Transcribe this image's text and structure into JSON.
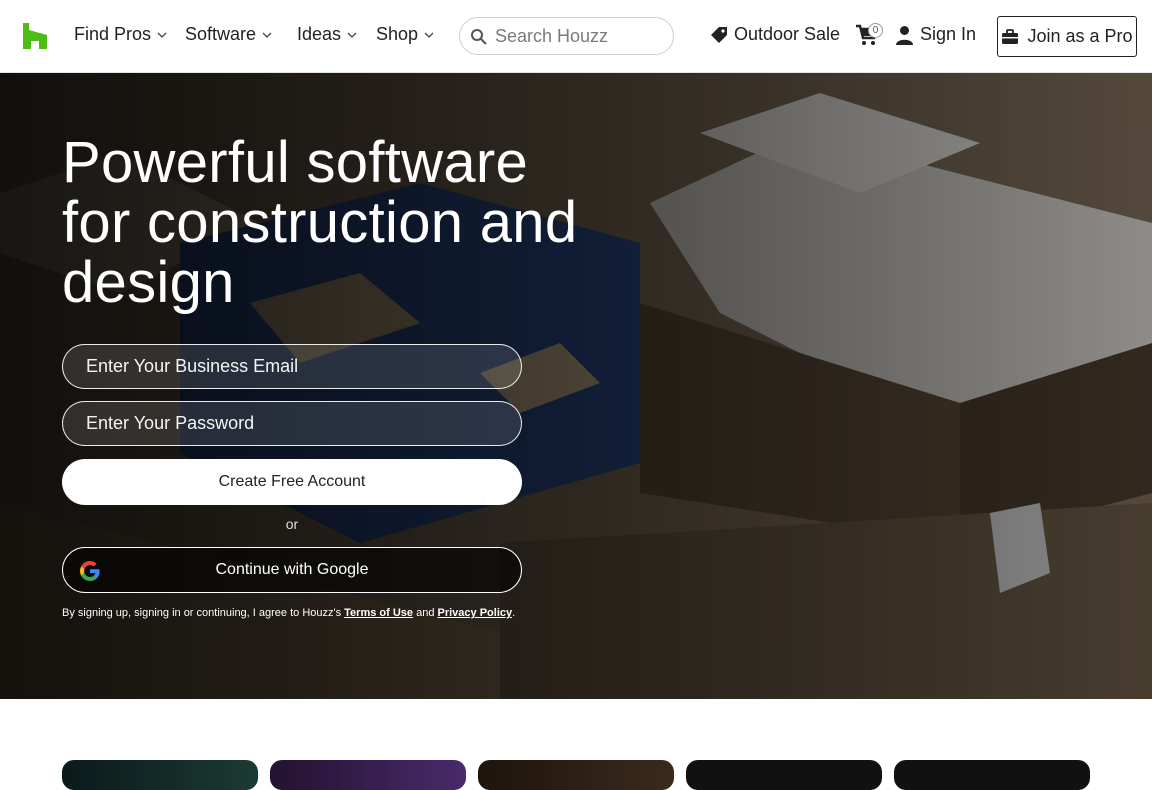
{
  "header": {
    "nav": [
      {
        "label": "Find Pros"
      },
      {
        "label": "Software"
      },
      {
        "label": "Ideas"
      },
      {
        "label": "Shop"
      }
    ],
    "search": {
      "placeholder": "Search Houzz"
    },
    "outdoor_sale": "Outdoor Sale",
    "cart_count": "0",
    "sign_in": "Sign In",
    "join": "Join as a Pro"
  },
  "hero": {
    "title": "Powerful software for construction and design",
    "email_placeholder": "Enter Your Business Email",
    "password_placeholder": "Enter Your Password",
    "create_account": "Create Free Account",
    "or": "or",
    "google": "Continue with Google",
    "legal_prefix": "By signing up, signing in or continuing, I agree to Houzz's ",
    "terms": "Terms of Use",
    "and": " and ",
    "privacy": "Privacy Policy",
    "period": "."
  },
  "colors": {
    "brand": "#4dbc15"
  }
}
